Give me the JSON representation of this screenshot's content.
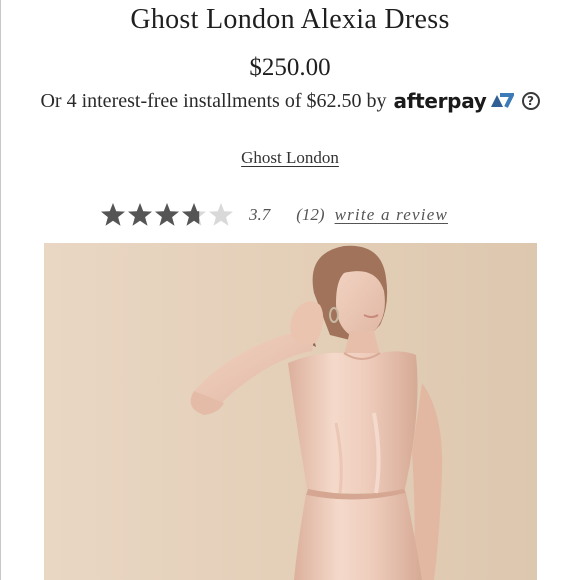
{
  "product": {
    "title": "Ghost London Alexia Dress",
    "price": "$250.00",
    "installments_text": "Or 4 interest-free installments of $62.50 by",
    "afterpay_label": "afterpay",
    "info_symbol": "?",
    "brand_link": "Ghost London"
  },
  "rating": {
    "value": "3.7",
    "stars_filled_fraction": 0.74,
    "review_count": "(12)",
    "write_review_label": "write a review"
  },
  "colors": {
    "star_filled": "#555555",
    "star_empty": "#d9d9d9",
    "image_background": "#e6d2bd",
    "dress": "#ecc9b7"
  },
  "icons": {
    "info": "info-circle-icon",
    "afterpay": "afterpay-logo-icon",
    "star": "star-icon"
  }
}
